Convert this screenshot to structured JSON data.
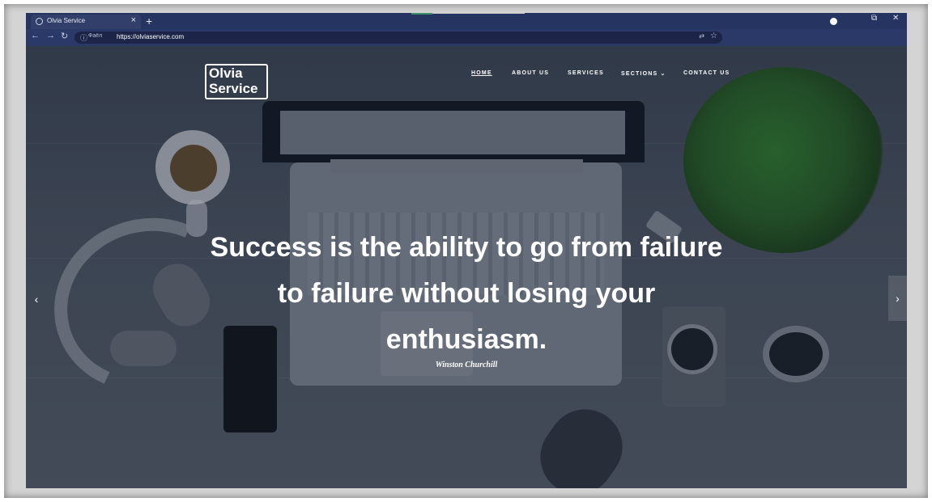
{
  "browser": {
    "tab_title": "Olvia Service",
    "new_tab_icon": "plus-icon",
    "url_secure_text": "Фаёл",
    "url": "https://olviaservice.com",
    "window_controls": {
      "restore": "⧉",
      "close": "✕"
    }
  },
  "site": {
    "logo_line1": "Olvia",
    "logo_line2": "Service",
    "menu": [
      {
        "label": "Home",
        "active": true
      },
      {
        "label": "About Us"
      },
      {
        "label": "Services"
      },
      {
        "label": "Sections"
      },
      {
        "label": "Contact Us"
      }
    ],
    "sections_dropdown_icon": "chevron-down-icon"
  },
  "hero": {
    "quote": "Success is the ability to go from failure to failure without losing your enthusiasm.",
    "author": "Winston Churchill"
  },
  "colors": {
    "tab_strip": "#253461",
    "toolbar": "#2b3969",
    "text": "#ffffff"
  }
}
